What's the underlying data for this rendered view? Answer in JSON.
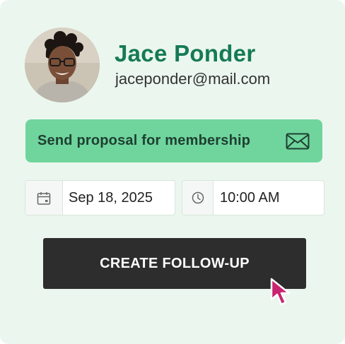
{
  "contact": {
    "name": "Jace Ponder",
    "email": "jaceponder@mail.com",
    "avatar_icon": "person-photo"
  },
  "proposal": {
    "label": "Send proposal for membership",
    "icon": "envelope-icon"
  },
  "date_field": {
    "value": "Sep 18, 2025",
    "icon": "calendar-icon"
  },
  "time_field": {
    "value": "10:00 AM",
    "icon": "clock-icon"
  },
  "cta": {
    "label": "CREATE FOLLOW-UP"
  },
  "colors": {
    "background": "#ebf7ee",
    "accent": "#157a55",
    "proposal_bg": "#6fd59d",
    "button_bg": "#2d2d2d",
    "cursor": "#c8246f"
  }
}
